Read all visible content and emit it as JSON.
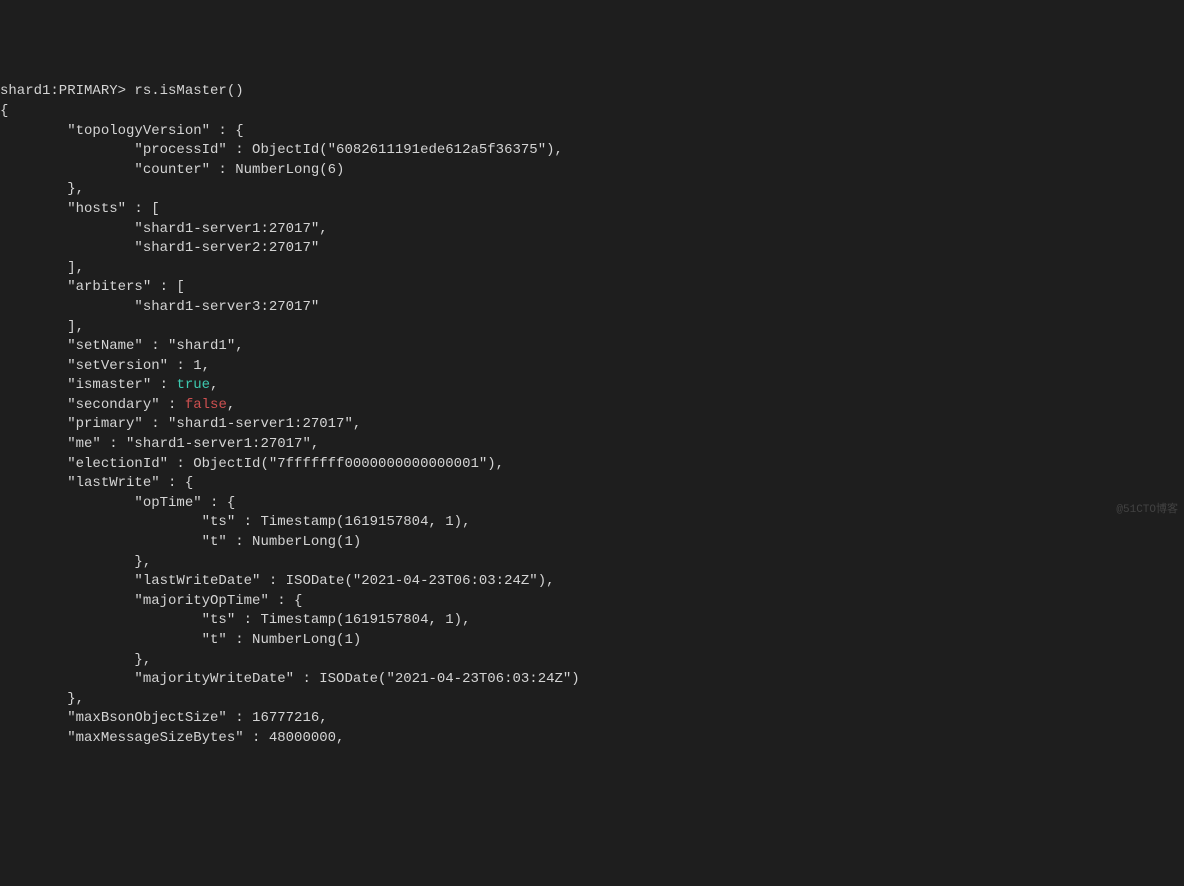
{
  "prompt": "shard1:PRIMARY> ",
  "command": "rs.isMaster()",
  "output": {
    "open_brace": "{",
    "topologyVersion_line": "        \"topologyVersion\" : {",
    "processId_line": "                \"processId\" : ObjectId(\"6082611191ede612a5f36375\"),",
    "counter_line": "                \"counter\" : NumberLong(6)",
    "topo_close_line": "        },",
    "hosts_line": "        \"hosts\" : [",
    "host1_line": "                \"shard1-server1:27017\",",
    "host2_line": "                \"shard1-server2:27017\"",
    "hosts_close_line": "        ],",
    "arbiters_line": "        \"arbiters\" : [",
    "arbiter1_line": "                \"shard1-server3:27017\"",
    "arbiters_close_line": "        ],",
    "setName_line": "        \"setName\" : \"shard1\",",
    "setVersion_line": "        \"setVersion\" : 1,",
    "ismaster_prefix": "        \"ismaster\" : ",
    "ismaster_value": "true",
    "ismaster_suffix": ",",
    "secondary_prefix": "        \"secondary\" : ",
    "secondary_value": "false",
    "secondary_suffix": ",",
    "primary_line": "        \"primary\" : \"shard1-server1:27017\",",
    "me_line": "        \"me\" : \"shard1-server1:27017\",",
    "electionId_line": "        \"electionId\" : ObjectId(\"7fffffff0000000000000001\"),",
    "lastWrite_line": "        \"lastWrite\" : {",
    "opTime_line": "                \"opTime\" : {",
    "opTime_ts_line": "                        \"ts\" : Timestamp(1619157804, 1),",
    "opTime_t_line": "                        \"t\" : NumberLong(1)",
    "opTime_close_line": "                },",
    "lastWriteDate_line": "                \"lastWriteDate\" : ISODate(\"2021-04-23T06:03:24Z\"),",
    "majorityOpTime_line": "                \"majorityOpTime\" : {",
    "majorityOpTime_ts_line": "                        \"ts\" : Timestamp(1619157804, 1),",
    "majorityOpTime_t_line": "                        \"t\" : NumberLong(1)",
    "majorityOpTime_close_line": "                },",
    "majorityWriteDate_line": "                \"majorityWriteDate\" : ISODate(\"2021-04-23T06:03:24Z\")",
    "lastWrite_close_line": "        },",
    "maxBsonObjectSize_line": "        \"maxBsonObjectSize\" : 16777216,",
    "maxMessageSizeBytes_line": "        \"maxMessageSizeBytes\" : 48000000,"
  },
  "watermark": "@51CTO博客"
}
